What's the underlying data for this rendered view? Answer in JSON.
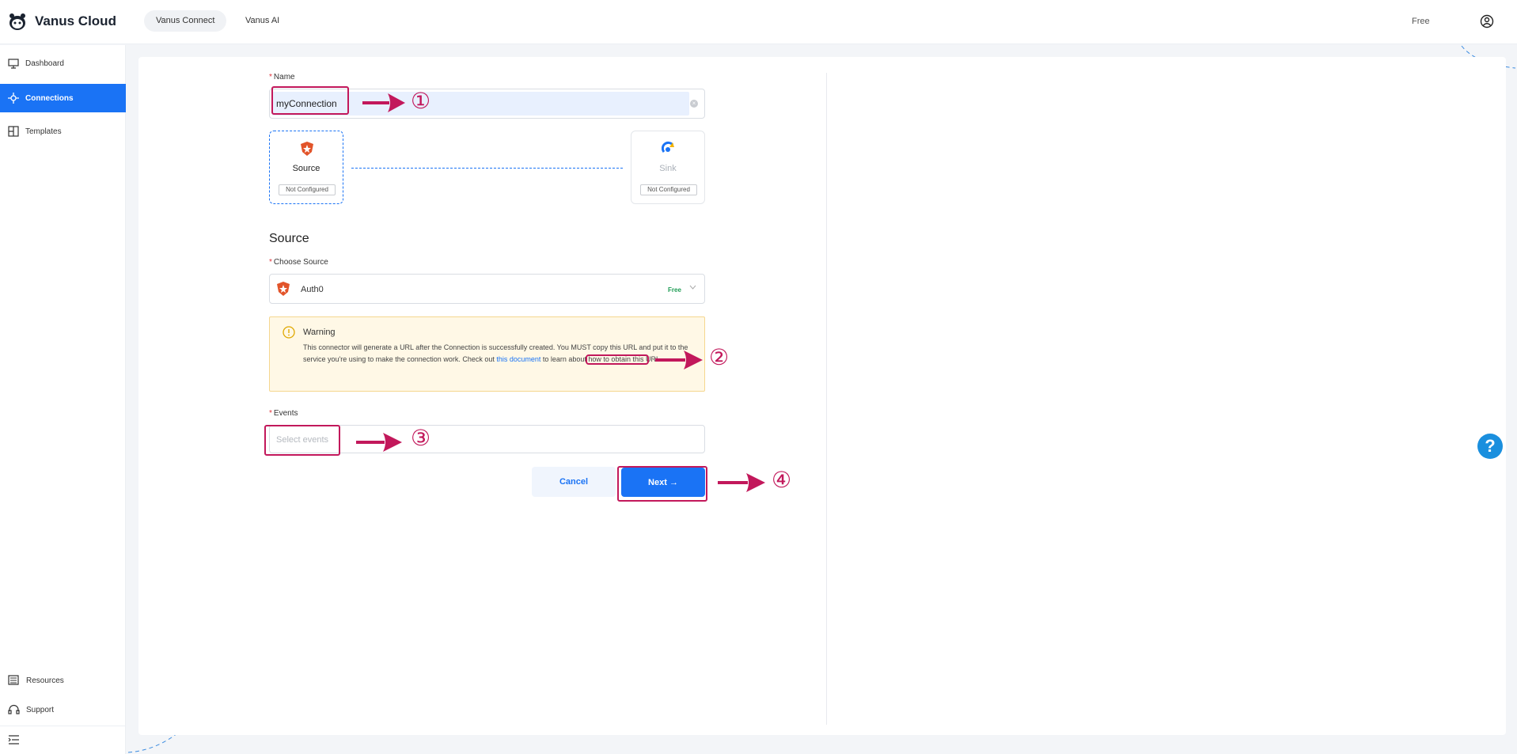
{
  "header": {
    "brand": "Vanus Cloud",
    "tabs": [
      {
        "label": "Vanus Connect",
        "active": true
      },
      {
        "label": "Vanus AI",
        "active": false
      }
    ],
    "plan": "Free",
    "user_icon": "user-circle-icon"
  },
  "sidebar": {
    "items": [
      {
        "label": "Dashboard",
        "icon": "monitor-icon",
        "active": false
      },
      {
        "label": "Connections",
        "icon": "connections-icon",
        "active": true
      },
      {
        "label": "Templates",
        "icon": "templates-icon",
        "active": false
      }
    ],
    "bottom_items": [
      {
        "label": "Resources",
        "icon": "resources-icon"
      },
      {
        "label": "Support",
        "icon": "support-icon"
      }
    ],
    "collapse_icon": "menu-collapse-icon"
  },
  "form": {
    "name_label": "Name",
    "name_value": "myConnection",
    "source_node": {
      "title": "Source",
      "status": "Not Configured",
      "icon": "auth0-icon"
    },
    "sink_node": {
      "title": "Sink",
      "status": "Not Configured",
      "icon": "sink-icon"
    },
    "section_title": "Source",
    "choose_source_label": "Choose Source",
    "source_value": "Auth0",
    "source_badge": "Free",
    "warning": {
      "title": "Warning",
      "text_before": "This connector will generate a URL after the Connection is successfully created. You MUST copy this URL and put it to the service you're using to make the connection work. Check out ",
      "link": "this document",
      "text_after": " to learn about how to obtain this URL."
    },
    "events_label": "Events",
    "events_placeholder": "Select events",
    "cancel_label": "Cancel",
    "next_label": "Next"
  },
  "annotations": {
    "step1": "①",
    "step2": "②",
    "step3": "③",
    "step4": "④",
    "color": "#c2185b"
  },
  "help_label": "?",
  "colors": {
    "primary": "#1a73f5",
    "warning_bg": "#fff8e6",
    "required": "#e0343b"
  }
}
